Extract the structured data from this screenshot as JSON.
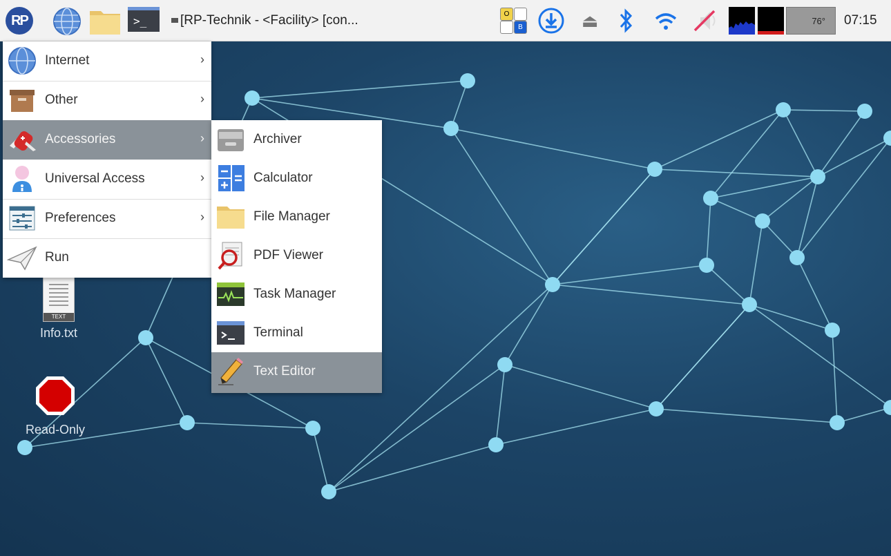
{
  "taskbar": {
    "logo_text": "RP",
    "terminal_glyph": ">_",
    "window_title": "[RP-Technik - <Facility> [con...",
    "ob_labels": [
      "O",
      "",
      "",
      "B"
    ],
    "temperature": "76°",
    "clock": "07:15",
    "icons": [
      "rp-logo-icon",
      "globe-icon",
      "folder-icon",
      "terminal-icon",
      "download-icon",
      "eject-icon",
      "bluetooth-icon",
      "wifi-icon",
      "volume-muted-icon"
    ],
    "colors": {
      "bluetooth": "#1a73e8",
      "download": "#1a73e8",
      "cpu_fill": "#1d39c9",
      "mem_fill": "#d11c1c"
    }
  },
  "desktop": {
    "icons": [
      {
        "label": "Info.txt",
        "tag": "TEXT"
      },
      {
        "label": "Read-Only"
      }
    ]
  },
  "main_menu": {
    "items": [
      {
        "label": "Internet",
        "icon": "globe-icon",
        "has_submenu": true
      },
      {
        "label": "Other",
        "icon": "box-icon",
        "has_submenu": true
      },
      {
        "label": "Accessories",
        "icon": "swiss-knife-icon",
        "has_submenu": true,
        "active": true
      },
      {
        "label": "Universal Access",
        "icon": "person-icon",
        "has_submenu": true
      },
      {
        "label": "Preferences",
        "icon": "sliders-icon",
        "has_submenu": true
      },
      {
        "label": "Run",
        "icon": "paper-plane-icon",
        "has_submenu": false
      }
    ],
    "arrow_glyph": "›"
  },
  "submenu": {
    "items": [
      {
        "label": "Archiver",
        "icon": "archive-icon"
      },
      {
        "label": "Calculator",
        "icon": "calculator-icon"
      },
      {
        "label": "File Manager",
        "icon": "folder-icon"
      },
      {
        "label": "PDF Viewer",
        "icon": "magnifier-icon"
      },
      {
        "label": "Task Manager",
        "icon": "activity-monitor-icon"
      },
      {
        "label": "Terminal",
        "icon": "terminal-icon"
      },
      {
        "label": "Text Editor",
        "icon": "pencil-icon",
        "active": true
      }
    ]
  },
  "wallpaper": {
    "line_color": "#a6e3f0",
    "node_color": "#8fdaf2"
  }
}
